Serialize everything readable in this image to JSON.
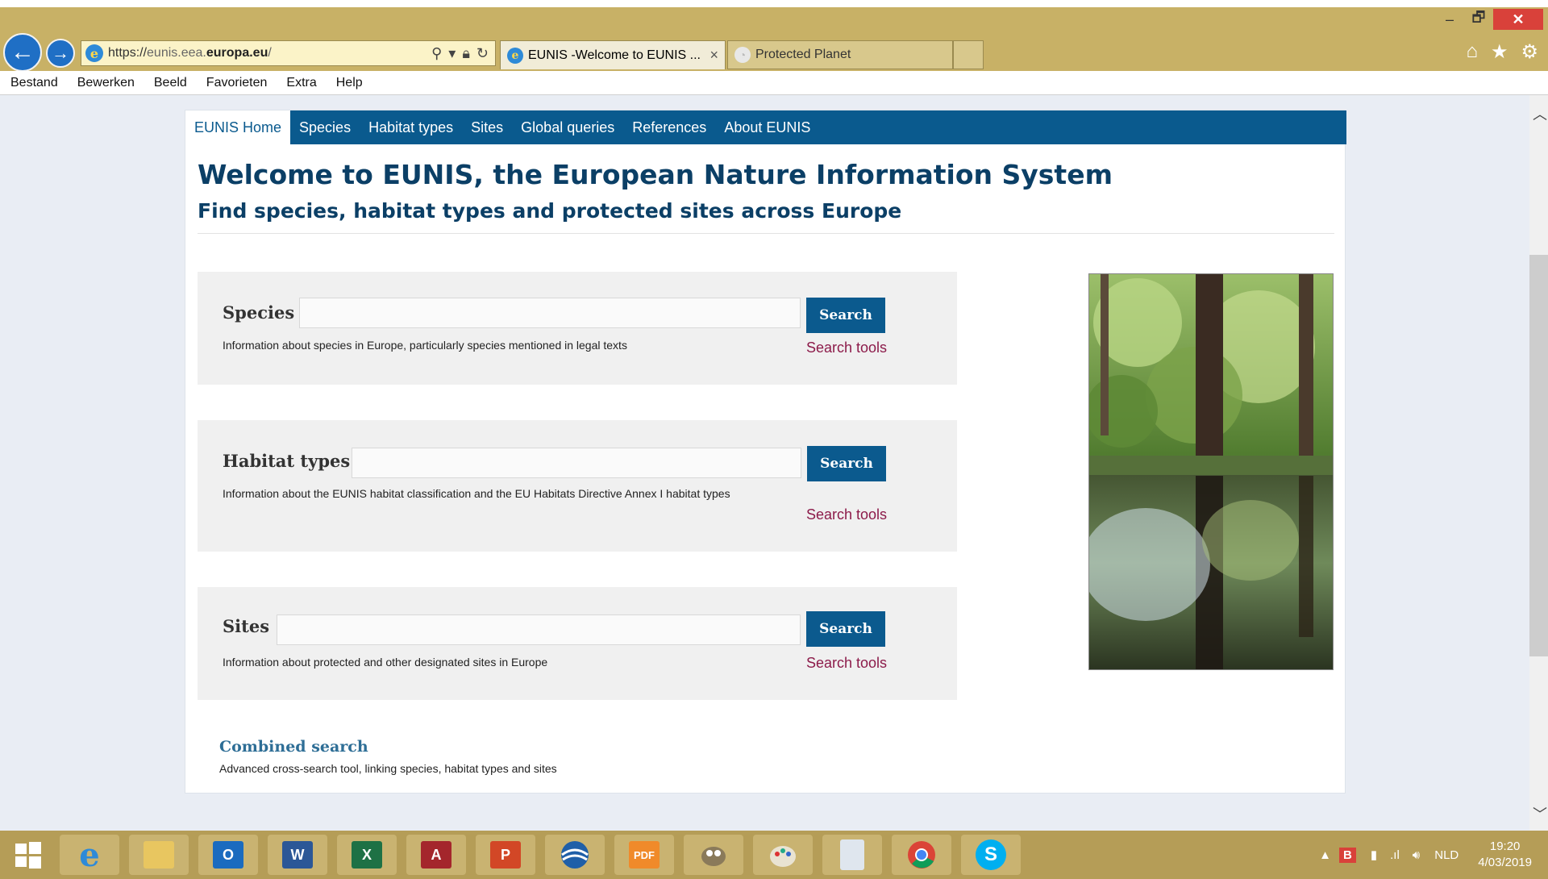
{
  "browser": {
    "address_url_prefix": "https://",
    "address_url_dim": "eunis.eea.",
    "address_url_bold": "europa.eu",
    "address_url_suffix": "/",
    "tabs": [
      {
        "title": "EUNIS -Welcome to EUNIS ...",
        "active": true
      },
      {
        "title": "Protected Planet",
        "active": false
      }
    ],
    "tab_close": "×",
    "window_controls": {
      "minimize": "–",
      "restore": "🗗",
      "close": "✕"
    },
    "toolbar_icons": [
      "home-icon",
      "favorites-star-icon",
      "settings-gear-icon"
    ]
  },
  "menubar": {
    "items": [
      "Bestand",
      "Bewerken",
      "Beeld",
      "Favorieten",
      "Extra",
      "Help"
    ]
  },
  "site_nav": {
    "items": [
      "EUNIS Home",
      "Species",
      "Habitat types",
      "Sites",
      "Global queries",
      "References",
      "About EUNIS"
    ],
    "active_index": 0
  },
  "page": {
    "title": "Welcome to EUNIS, the European Nature Information System",
    "subtitle": "Find species, habitat types and protected sites across Europe"
  },
  "search_panels": [
    {
      "label": "Species",
      "button": "Search",
      "description": "Information about species in Europe, particularly species mentioned in legal texts",
      "tools_link": "Search tools"
    },
    {
      "label": "Habitat types",
      "button": "Search",
      "description": "Information about the EUNIS habitat classification and the EU Habitats Directive Annex I habitat types",
      "tools_link": "Search tools"
    },
    {
      "label": "Sites",
      "button": "Search",
      "description": "Information about protected and other designated sites in Europe",
      "tools_link": "Search tools"
    }
  ],
  "combined_search": {
    "title": "Combined search",
    "description": "Advanced cross-search tool, linking species, habitat types and sites"
  },
  "taskbar": {
    "apps": [
      "windows-start-icon",
      "internet-explorer-icon",
      "file-explorer-icon",
      "outlook-icon",
      "word-icon",
      "excel-icon",
      "access-icon",
      "powerpoint-icon",
      "globe-app-icon",
      "pdf-app-icon",
      "gimp-icon",
      "paint-icon",
      "calculator-icon",
      "chrome-icon",
      "skype-icon"
    ],
    "tray_language": "NLD",
    "clock_time": "19:20",
    "clock_date": "4/03/2019"
  },
  "colors": {
    "chrome_bg": "#c8b166",
    "site_nav_bg": "#0a5a8e",
    "heading": "#0b3f66",
    "search_button": "#0b5a8e",
    "tools_link": "#8c1b4a",
    "taskbar_bg": "#b59d57"
  }
}
